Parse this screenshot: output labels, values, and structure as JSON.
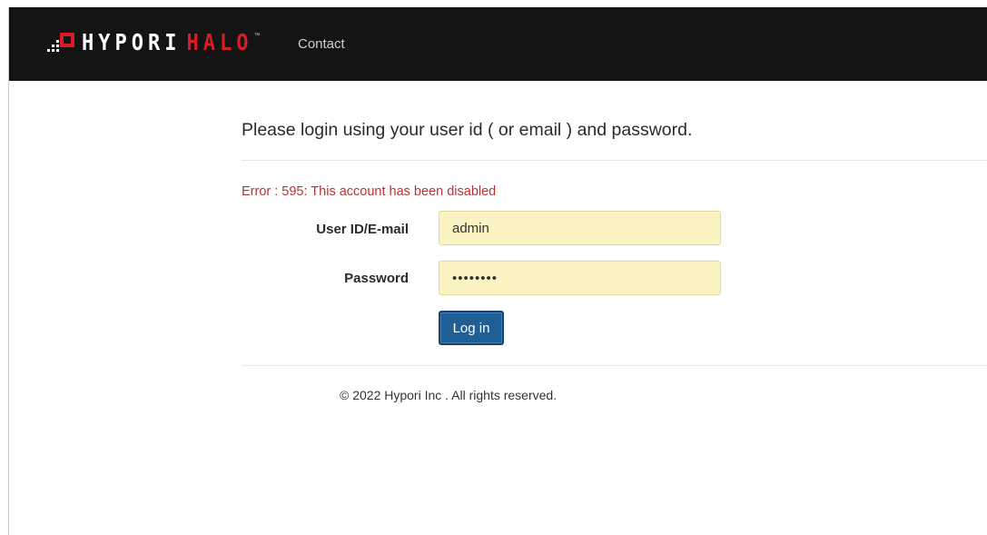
{
  "navbar": {
    "logo_text_white": "HYPORI",
    "logo_text_red": "HALO",
    "logo_tm": "™",
    "contact_label": "Contact"
  },
  "login": {
    "heading": "Please login using your user id ( or email ) and password.",
    "error_message": "Error : 595: This account has been disabled",
    "user_label": "User ID/E-mail",
    "user_value": "admin",
    "password_label": "Password",
    "password_value": "passwrd1",
    "submit_label": "Log in"
  },
  "footer": {
    "copyright": "© 2022 Hypori Inc . All rights reserved."
  },
  "colors": {
    "navbar_bg": "#141414",
    "brand_red": "#d81b24",
    "error_red": "#b03535",
    "input_autofill": "#fbf4c2",
    "button_blue": "#1f5f95"
  }
}
